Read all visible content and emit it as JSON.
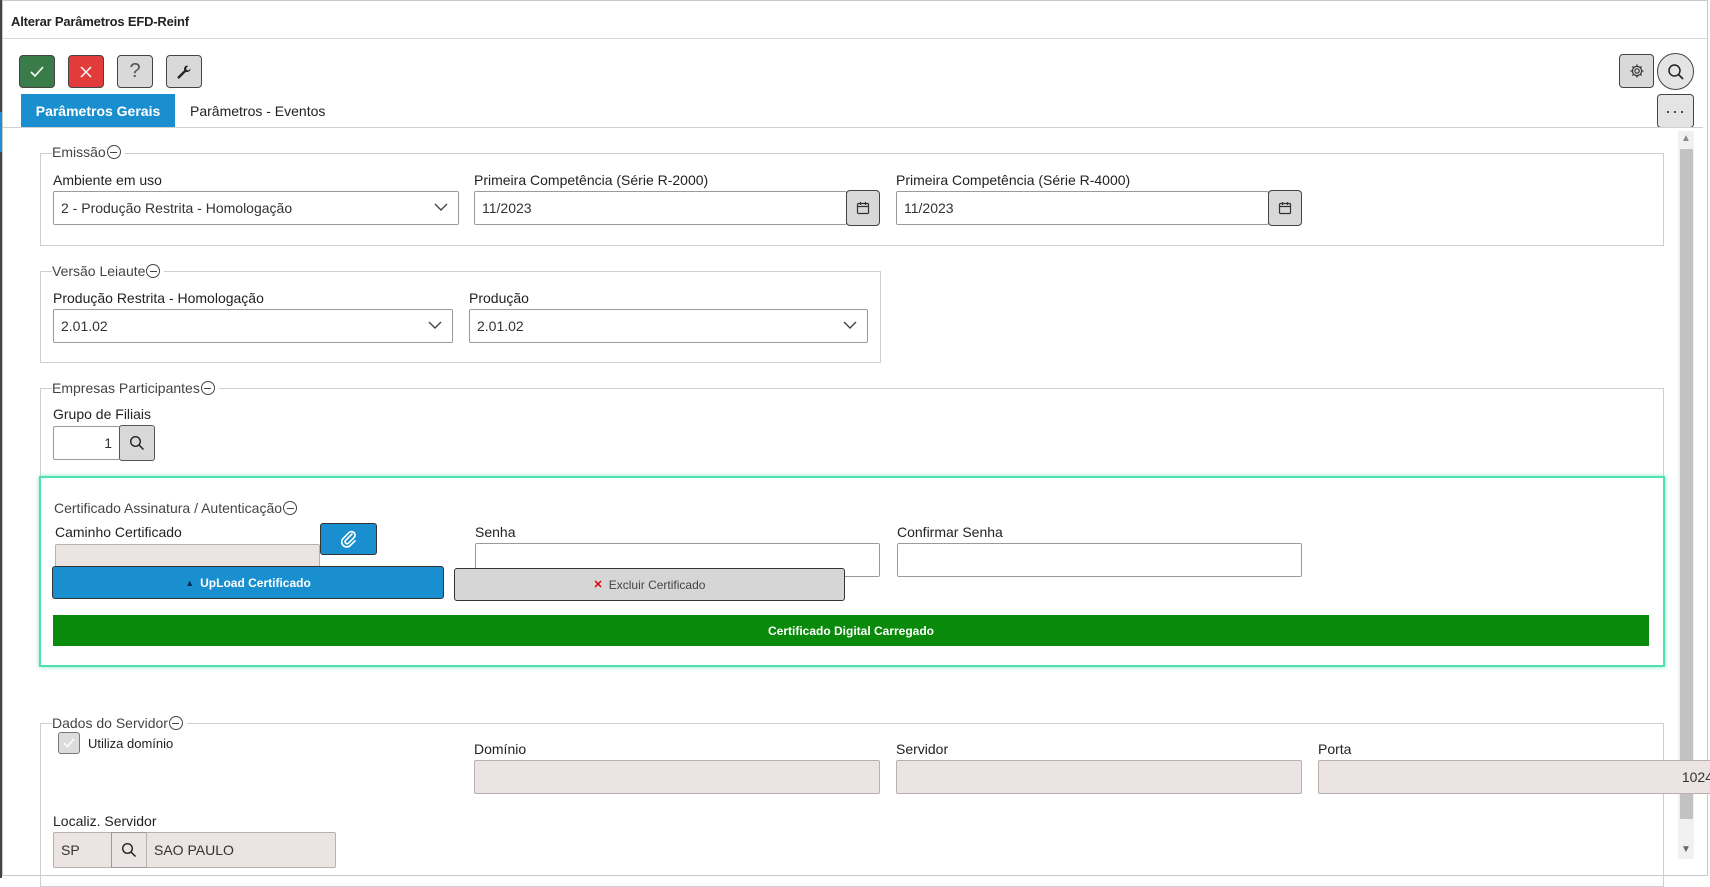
{
  "window": {
    "title": "Alterar Parâmetros EFD-Reinf"
  },
  "toolbar": {
    "confirm_icon": "check-icon",
    "cancel_icon": "close-icon",
    "help_label": "?",
    "tools_icon": "wrench-icon",
    "settings_icon": "gear-icon",
    "search_icon": "search-icon",
    "more_label": "···"
  },
  "tabs": [
    {
      "label": "Parâmetros Gerais",
      "active": true
    },
    {
      "label": "Parâmetros - Eventos",
      "active": false
    }
  ],
  "emissao": {
    "legend": "Emissão",
    "ambiente_label": "Ambiente em uso",
    "ambiente_value": "2 - Produção Restrita - Homologação",
    "comp_r2000_label": "Primeira Competência (Série R-2000)",
    "comp_r2000_value": "11/2023",
    "comp_r4000_label": "Primeira Competência (Série R-4000)",
    "comp_r4000_value": "11/2023"
  },
  "versao": {
    "legend": "Versão Leiaute",
    "homolog_label": "Produção Restrita - Homologação",
    "homolog_value": "2.01.02",
    "producao_label": "Produção",
    "producao_value": "2.01.02"
  },
  "empresas": {
    "legend": "Empresas Participantes",
    "grupo_label": "Grupo de Filiais",
    "grupo_value": "1"
  },
  "certificado": {
    "legend": "Certificado Assinatura / Autenticação",
    "caminho_label": "Caminho Certificado",
    "caminho_value": "",
    "senha_label": "Senha",
    "confirmar_label": "Confirmar Senha",
    "upload_label": "UpLoad Certificado",
    "excluir_label": "Excluir Certificado",
    "status_text": "Certificado Digital Carregado",
    "status_color": "#0a8a0a"
  },
  "servidor": {
    "legend": "Dados do Servidor",
    "utiliza_dominio_label": "Utiliza domínio",
    "utiliza_dominio_checked": false,
    "dominio_label": "Domínio",
    "dominio_value": "",
    "servidor_label": "Servidor",
    "servidor_value": "",
    "porta_label": "Porta",
    "porta_value": "1024",
    "localiz_label": "Localiz. Servidor",
    "uf_value": "SP",
    "cidade_value": "SAO PAULO"
  }
}
